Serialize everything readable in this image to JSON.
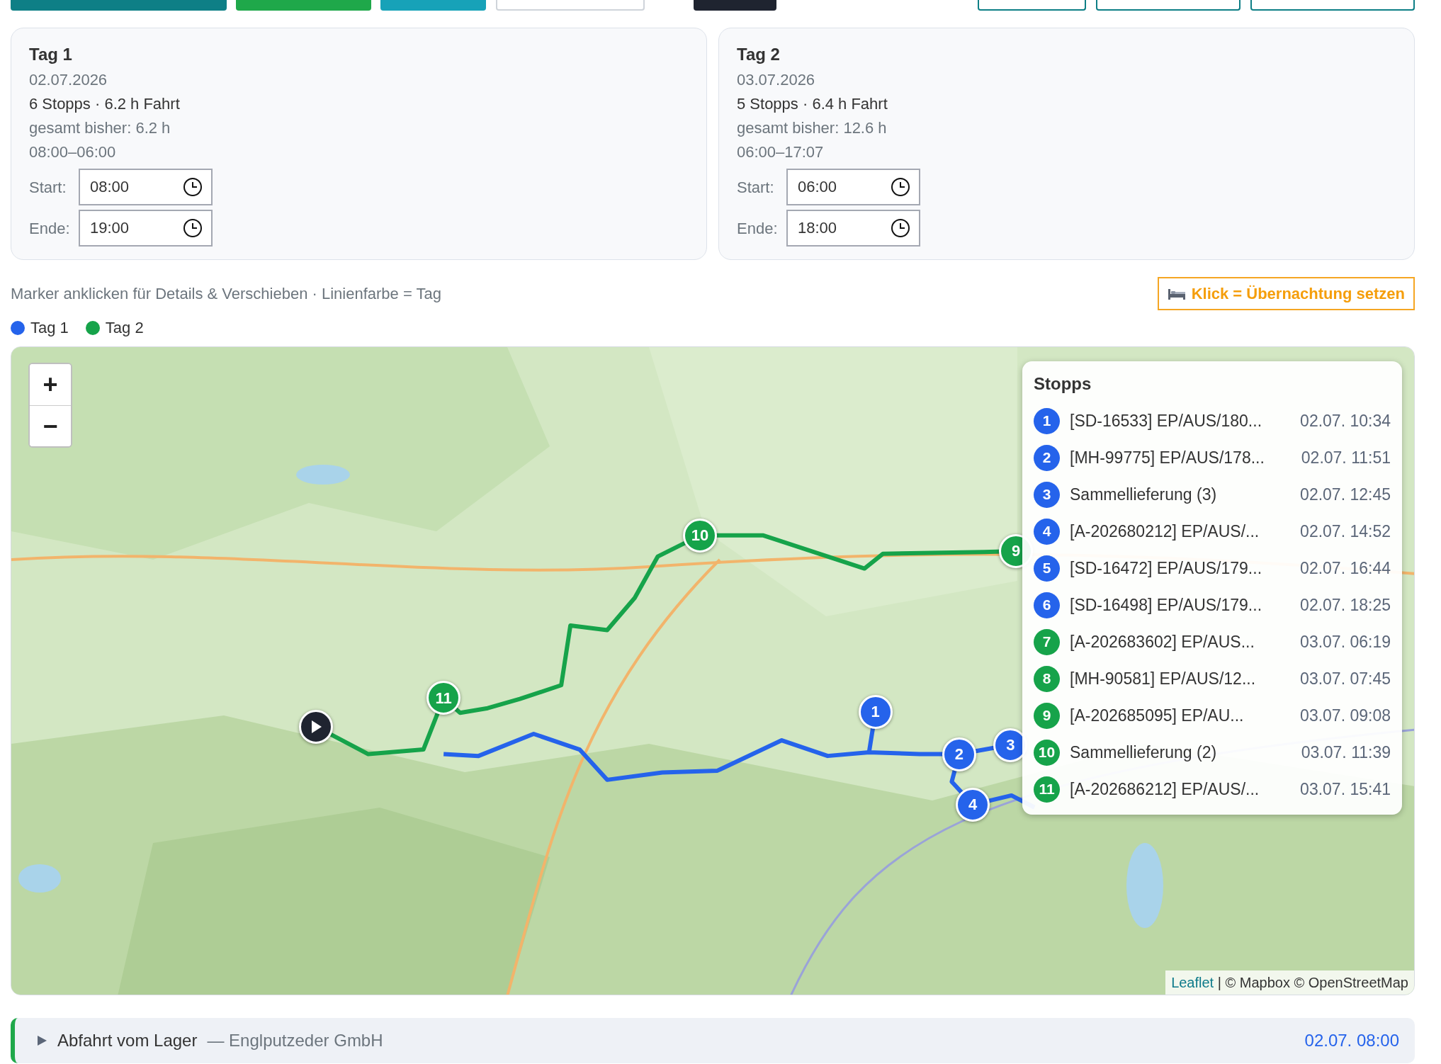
{
  "toolbar_buttons": [
    {
      "kind": "filled",
      "color": "#0e7f86"
    },
    {
      "kind": "filled",
      "color": "#1fa84a"
    },
    {
      "kind": "filled",
      "color": "#17a2b8"
    },
    {
      "kind": "outline",
      "color": "#cfd4da"
    },
    {
      "kind": "filled",
      "color": "#1f2430"
    },
    {
      "kind": "outline",
      "color": "#0e7f86"
    },
    {
      "kind": "outline",
      "color": "#0e7f86"
    },
    {
      "kind": "outline",
      "color": "#0e7f86"
    }
  ],
  "days": [
    {
      "title": "Tag 1",
      "date": "02.07.2026",
      "summary": "6 Stopps · 6.2 h Fahrt",
      "total": "gesamt bisher: 6.2 h",
      "window": "08:00–06:00",
      "start_label": "Start:",
      "start": "08:00",
      "end_label": "Ende:",
      "end": "19:00"
    },
    {
      "title": "Tag 2",
      "date": "03.07.2026",
      "summary": "5 Stopps · 6.4 h Fahrt",
      "total": "gesamt bisher: 12.6 h",
      "window": "06:00–17:07",
      "start_label": "Start:",
      "start": "06:00",
      "end_label": "Ende:",
      "end": "18:00"
    }
  ],
  "hint": "Marker anklicken für Details & Verschieben · Linienfarbe = Tag",
  "overnight_button": "Klick = Übernachtung setzen",
  "legend": [
    {
      "label": "Tag 1",
      "color": "#2563eb"
    },
    {
      "label": "Tag 2",
      "color": "#16a34a"
    }
  ],
  "map": {
    "kind": "picture",
    "zoom_in": "+",
    "zoom_out": "−",
    "markers": [
      {
        "kind": "start",
        "color": "#1f2430"
      },
      {
        "kind": "stop",
        "label": "1",
        "color": "#2563eb"
      },
      {
        "kind": "stop",
        "label": "2",
        "color": "#2563eb"
      },
      {
        "kind": "stop",
        "label": "3",
        "color": "#2563eb"
      },
      {
        "kind": "stop",
        "label": "4",
        "color": "#2563eb"
      },
      {
        "kind": "stop",
        "label": "10",
        "color": "#16a34a"
      },
      {
        "kind": "stop",
        "label": "11",
        "color": "#16a34a"
      },
      {
        "kind": "stop",
        "label": "9",
        "color": "#16a34a"
      }
    ],
    "stops_title": "Stopps",
    "stops": [
      {
        "number": "1",
        "name": "[SD-16533] EP/AUS/180...",
        "time": "02.07. 10:34",
        "color": "#2563eb"
      },
      {
        "number": "2",
        "name": "[MH-99775] EP/AUS/178...",
        "time": "02.07. 11:51",
        "color": "#2563eb"
      },
      {
        "number": "3",
        "name": "Sammellieferung (3)",
        "time": "02.07. 12:45",
        "color": "#2563eb"
      },
      {
        "number": "4",
        "name": "[A-202680212] EP/AUS/...",
        "time": "02.07. 14:52",
        "color": "#2563eb"
      },
      {
        "number": "5",
        "name": "[SD-16472] EP/AUS/179...",
        "time": "02.07. 16:44",
        "color": "#2563eb"
      },
      {
        "number": "6",
        "name": "[SD-16498] EP/AUS/179...",
        "time": "02.07. 18:25",
        "color": "#2563eb"
      },
      {
        "number": "7",
        "name": "[A-202683602] EP/AUS...",
        "time": "03.07. 06:19",
        "color": "#16a34a"
      },
      {
        "number": "8",
        "name": "[MH-90581] EP/AUS/12...",
        "time": "03.07. 07:45",
        "color": "#16a34a"
      },
      {
        "number": "9",
        "name": "[A-202685095] EP/AU...",
        "time": "03.07. 09:08",
        "color": "#16a34a"
      },
      {
        "number": "10",
        "name": "Sammellieferung (2)",
        "time": "03.07. 11:39",
        "color": "#16a34a"
      },
      {
        "number": "11",
        "name": "[A-202686212] EP/AUS/...",
        "time": "03.07. 15:41",
        "color": "#16a34a"
      }
    ],
    "attribution_link": "Leaflet",
    "attribution_text": "| © Mapbox © OpenStreetMap"
  },
  "departure": {
    "expanded": false,
    "title": "Abfahrt vom Lager",
    "company": "— Englputzeder GmbH",
    "time": "02.07. 08:00"
  }
}
